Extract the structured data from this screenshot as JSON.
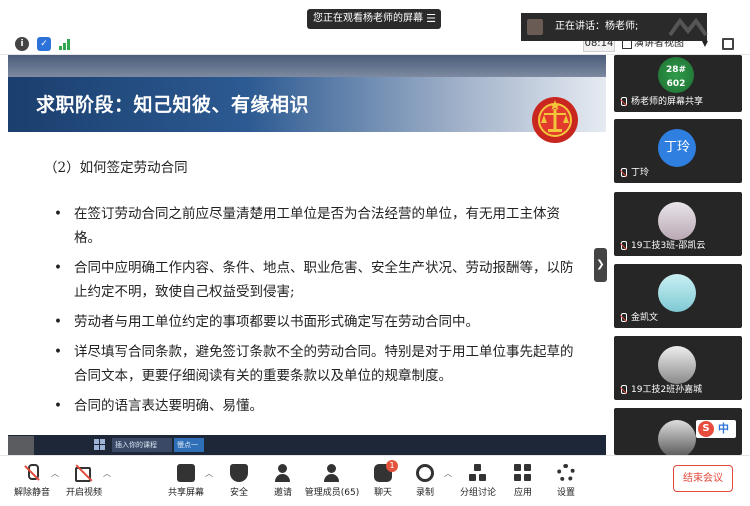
{
  "top": {
    "share_notice": "您正在观看杨老师的屏幕",
    "speaker_notice": "正在讲话：杨老师;"
  },
  "meeting_bar": {
    "timer": "08:14",
    "view_label": "演讲者视图"
  },
  "slide": {
    "title": "求职阶段：知己知彼、有缘相识",
    "subtitle": "（2）如何签定劳动合同",
    "bullets": [
      "在签订劳动合同之前应尽量清楚用工单位是否为合法经营的单位，有无用工主体资格。",
      "合同中应明确工作内容、条件、地点、职业危害、安全生产状况、劳动报酬等，以防止约定不明，致使自己权益受到侵害;",
      "劳动者与用工单位约定的事项都要以书面形式确定写在劳动合同中。",
      "详尽填写合同条款，避免签订条款不全的劳动合同。特别是对于用工单位事先起草的合同文本，更要仔细阅读有关的重要条款以及单位的规章制度。",
      "合同的语言表达要明确、易懂。"
    ],
    "taskbar_items": [
      "插入你的课程",
      "慢点一下"
    ]
  },
  "participants": [
    {
      "name": "杨老师的屏幕共享",
      "avatar_text": "28# 602"
    },
    {
      "name": "丁玲",
      "avatar_text": "丁玲"
    },
    {
      "name": "19工技3班-邵凯云",
      "avatar_text": ""
    },
    {
      "name": "金凯文",
      "avatar_text": ""
    },
    {
      "name": "19工技2班孙嘉城",
      "avatar_text": ""
    },
    {
      "name": "",
      "avatar_text": ""
    }
  ],
  "ime": {
    "badge": "S",
    "text": "中"
  },
  "toolbar": {
    "mute": "解除静音",
    "video": "开启视频",
    "share": "共享屏幕",
    "security": "安全",
    "invite": "邀请",
    "members": "管理成员(65)",
    "chat": "聊天",
    "chat_badge": "1",
    "record": "录制",
    "breakout": "分组讨论",
    "apps": "应用",
    "settings": "设置",
    "end": "结束会议"
  }
}
